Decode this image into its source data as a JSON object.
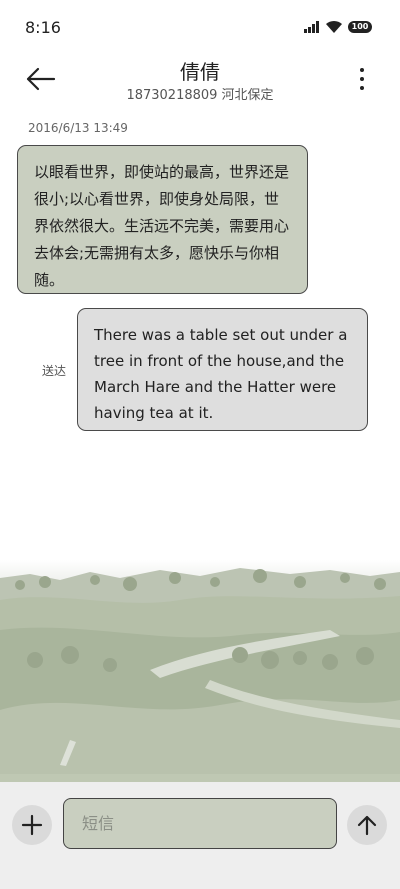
{
  "status_bar": {
    "time": "8:16",
    "battery": "100"
  },
  "header": {
    "title": "倩倩",
    "subtitle": "18730218809 河北保定"
  },
  "conversation": {
    "timestamp": "2016/6/13 13:49",
    "incoming_message": "以眼看世界，即使站的最高，世界还是很小;以心看世界，即使身处局限，世界依然很大。生活远不完美，需要用心去体会;无需拥有太多，愿快乐与你相随。",
    "outgoing_message": "There was a table set out under a tree in front of the house,and the March Hare and the Hatter were having tea at it.",
    "outgoing_status": "送达"
  },
  "composer": {
    "placeholder": "短信"
  },
  "icons": {
    "back": "arrow-left-icon",
    "more": "more-vertical-icon",
    "add": "plus-icon",
    "send": "arrow-up-icon",
    "signal": "signal-icon",
    "wifi": "wifi-icon",
    "battery": "battery-icon"
  }
}
